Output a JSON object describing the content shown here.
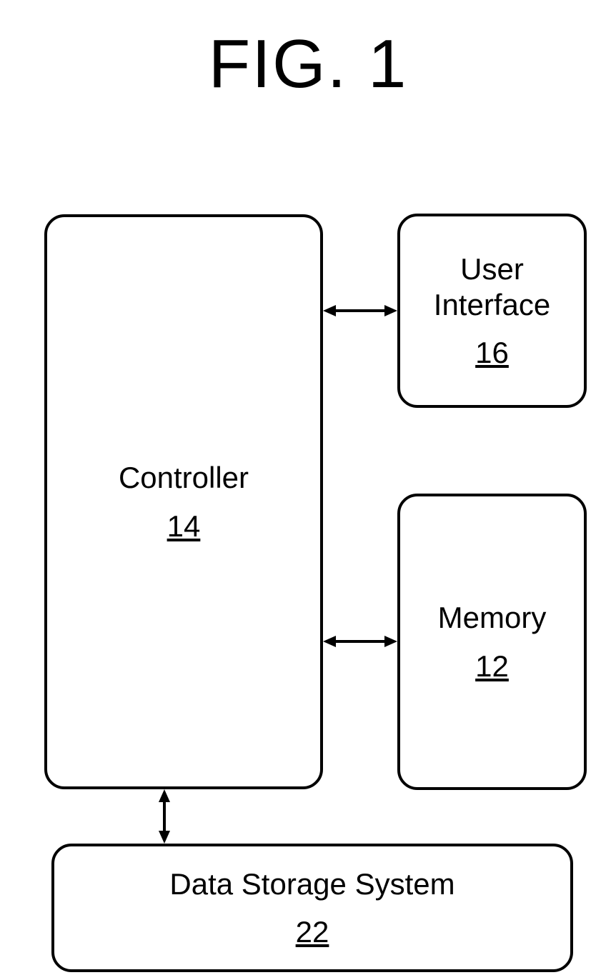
{
  "title": "FIG. 1",
  "blocks": {
    "controller": {
      "label": "Controller",
      "ref": "14"
    },
    "user_interface": {
      "label_line1": "User",
      "label_line2": "Interface",
      "ref": "16"
    },
    "memory": {
      "label": "Memory",
      "ref": "12"
    },
    "data_storage": {
      "label": "Data Storage System",
      "ref": "22"
    }
  }
}
